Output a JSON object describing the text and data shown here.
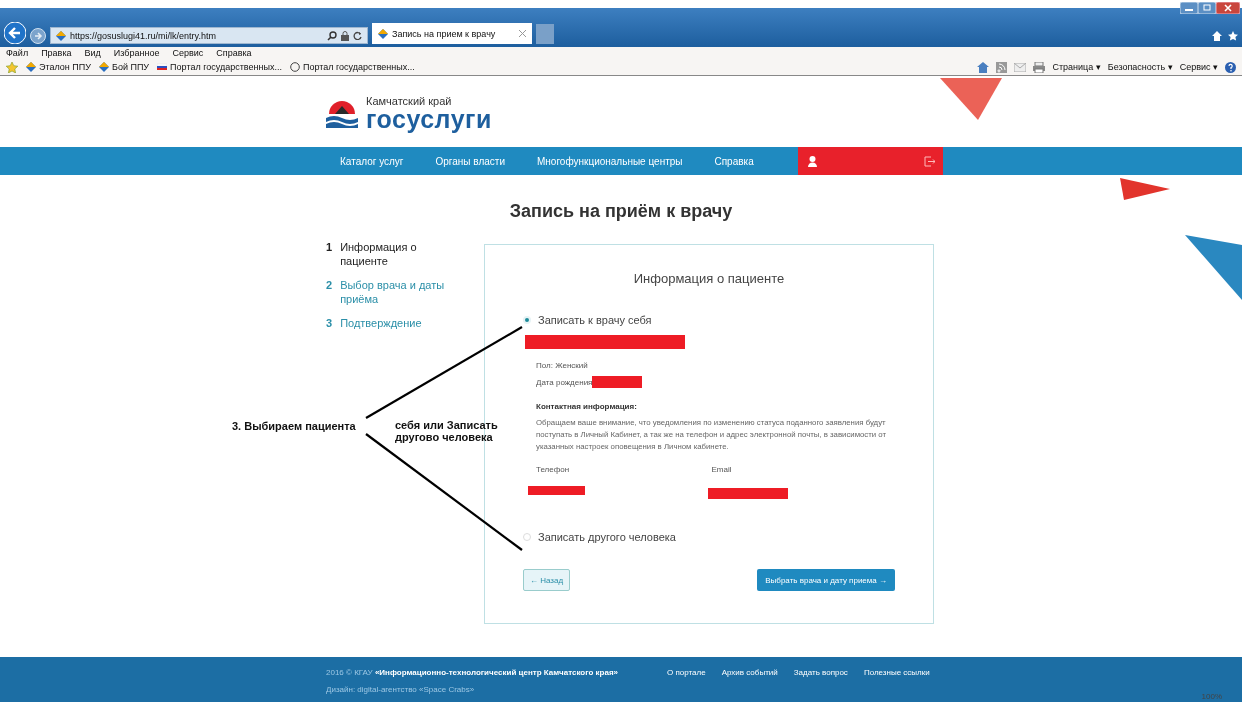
{
  "browser": {
    "address": "https://gosuslugi41.ru/mi/lk/entry.htm",
    "tab": {
      "title": "Запись на прием к врачу",
      "selected": true
    },
    "menu": [
      "Файл",
      "Правка",
      "Вид",
      "Избранное",
      "Сервис",
      "Справка"
    ],
    "favorites": [
      "Эталон ППУ",
      "Бой ППУ",
      "Портал государственных...",
      "Портал государственных..."
    ],
    "commands": [
      "Страница ▾",
      "Безопасность ▾",
      "Сервис ▾"
    ],
    "zoom": "100%"
  },
  "site": {
    "region": "Камчатский край",
    "brand": "госуслуги",
    "nav": [
      "Каталог услуг",
      "Органы власти",
      "Многофункциональные центры",
      "Справка"
    ]
  },
  "page_title": "Запись на приём к врачу",
  "steps": [
    {
      "number": "1",
      "label": "Информация о пациенте",
      "selected": true
    },
    {
      "number": "2",
      "label": "Выбор врача и даты приёма",
      "selected": false
    },
    {
      "number": "3",
      "label": "Подтверждение",
      "selected": false
    }
  ],
  "card": {
    "heading": "Информация о пациенте",
    "options": [
      {
        "label": "Записать к врачу себя",
        "selected": true
      },
      {
        "label": "Записать другого человека",
        "selected": false
      }
    ],
    "gender": "Пол: Женский",
    "birth_label": "Дата рождения",
    "contact_heading": "Контактная информация:",
    "notice": "Обращаем ваше внимание, что уведомления по изменению статуса поданного заявления будут поступать в Личный Кабинет, а так же на телефон и адрес электронной почты, в зависимости от указанных настроек оповещения в Личном кабинете.",
    "phone_label": "Телефон",
    "email_label": "Email",
    "back_button": "← Назад",
    "next_button": "Выбрать врача и дату приема →"
  },
  "annotations": [
    "3. Выбираем пациента",
    "себя или Записать другово человека"
  ],
  "footer": {
    "copyright": "2016 © КГАУ **«Информационно-технологический центр Камчатского края»**",
    "links": [
      "О портале",
      "Архив событий",
      "Задать вопрос",
      "Полезные ссылки"
    ],
    "design": "Дизайн: digital-агентство «Space Crabs»"
  }
}
